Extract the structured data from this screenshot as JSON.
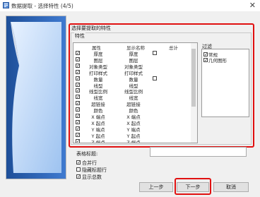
{
  "window": {
    "title": "数据提取 - 选择特性 (4/5)"
  },
  "group": {
    "label": "选择要提取的特性"
  },
  "properties": {
    "legend": "特性",
    "columns": [
      "属性",
      "显示名称",
      "总计"
    ],
    "rows": [
      {
        "checked": true,
        "name": "厚度",
        "display": "厚度",
        "total": true
      },
      {
        "checked": true,
        "name": "图层",
        "display": "图层",
        "total": false
      },
      {
        "checked": true,
        "name": "对象类型",
        "display": "对象类型",
        "total": false
      },
      {
        "checked": true,
        "name": "打印样式",
        "display": "打印样式",
        "total": false
      },
      {
        "checked": true,
        "name": "数量",
        "display": "数量",
        "total": true
      },
      {
        "checked": true,
        "name": "线型",
        "display": "线型",
        "total": false
      },
      {
        "checked": true,
        "name": "线型比例",
        "display": "线型比例",
        "total": false
      },
      {
        "checked": true,
        "name": "线宽",
        "display": "线宽",
        "total": false
      },
      {
        "checked": true,
        "name": "超链接",
        "display": "超链接",
        "total": false
      },
      {
        "checked": true,
        "name": "颜色",
        "display": "颜色",
        "total": false
      },
      {
        "checked": true,
        "name": "X 端点",
        "display": "X 端点",
        "total": false
      },
      {
        "checked": true,
        "name": "X 起点",
        "display": "X 起点",
        "total": false
      },
      {
        "checked": true,
        "name": "Y 端点",
        "display": "Y 端点",
        "total": false
      },
      {
        "checked": true,
        "name": "Y 起点",
        "display": "Y 起点",
        "total": false
      },
      {
        "checked": true,
        "name": "Z 端点",
        "display": "Z 端点",
        "total": false
      }
    ]
  },
  "filter": {
    "label": "过滤",
    "items": [
      {
        "checked": true,
        "label": "常规"
      },
      {
        "checked": true,
        "label": "几何图形"
      }
    ]
  },
  "table_title": {
    "label": "表格标题:",
    "value": ""
  },
  "options": [
    {
      "checked": true,
      "label": "合并行"
    },
    {
      "checked": false,
      "label": "隐藏标题行"
    },
    {
      "checked": true,
      "label": "显示总数"
    }
  ],
  "buttons": {
    "back": "上一步",
    "next": "下一步",
    "cancel": "取消"
  },
  "colors": {
    "highlight": "#e01010"
  }
}
